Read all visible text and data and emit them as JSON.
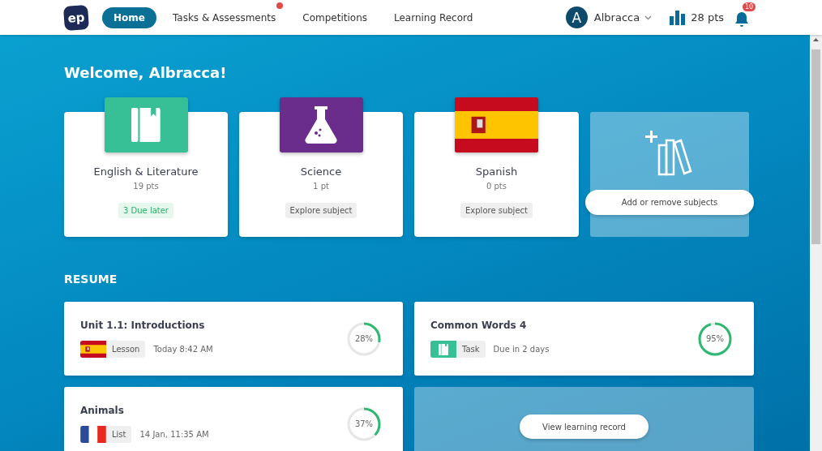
{
  "header": {
    "logo": "ep",
    "nav": [
      {
        "label": "Home",
        "selected": true,
        "alert": false
      },
      {
        "label": "Tasks & Assessments",
        "selected": false,
        "alert": true
      },
      {
        "label": "Competitions",
        "selected": false,
        "alert": false
      },
      {
        "label": "Learning Record",
        "selected": false,
        "alert": false
      }
    ],
    "user": {
      "initial": "A",
      "name": "Albracca"
    },
    "points": "28 pts",
    "notifications": "10"
  },
  "welcome": "Welcome, Albracca!",
  "subjects": [
    {
      "kind": "book",
      "name": "English & Literature",
      "points": "19 pts",
      "action": {
        "kind": "due",
        "label": "3 Due later"
      }
    },
    {
      "kind": "flask",
      "name": "Science",
      "points": "1 pt",
      "action": {
        "kind": "explore",
        "label": "Explore subject"
      }
    },
    {
      "kind": "spain",
      "name": "Spanish",
      "points": "0 pts",
      "action": {
        "kind": "explore",
        "label": "Explore subject"
      }
    }
  ],
  "add_subjects": "Add or remove subjects",
  "resume": {
    "title": "RESUME",
    "items": [
      {
        "title": "Unit 1.1: Introductions",
        "kind": "spain",
        "tag": "Lesson",
        "when": "Today 8:42 AM",
        "percent": "28%",
        "level": 0.28
      },
      {
        "title": "Common Words 4",
        "kind": "task",
        "tag": "Task",
        "when": "Due in 2 days",
        "percent": "95%",
        "level": 0.95
      },
      {
        "title": "Animals",
        "kind": "france",
        "tag": "List",
        "when": "14 Jan, 11:35 AM",
        "percent": "37%",
        "level": 0.37
      }
    ],
    "record_button": "View learning record"
  }
}
